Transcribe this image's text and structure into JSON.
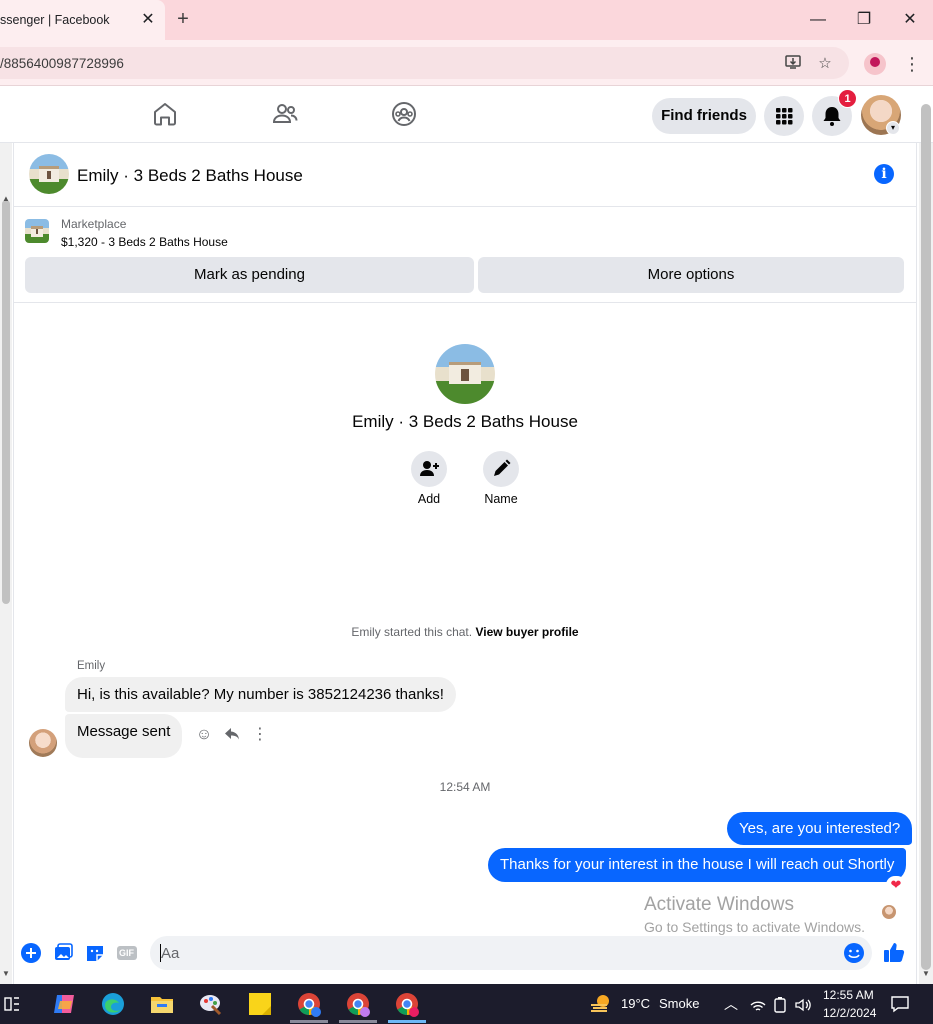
{
  "browser": {
    "tab_title": "ssenger | Facebook",
    "tab_close": "✕",
    "new_tab": "+",
    "url": "/8856400987728996",
    "window_minimize": "—",
    "window_restore": "❐",
    "window_close": "✕",
    "menu": "⋮"
  },
  "fb_nav": {
    "find_friends": "Find friends",
    "notification_count": "1"
  },
  "chat": {
    "title": "Emily · 3 Beds 2 Baths House",
    "marketplace_label": "Marketplace",
    "listing": "$1,320 - 3 Beds 2 Baths House",
    "mark_pending": "Mark as pending",
    "more_options": "More options",
    "profile_name": "Emily · 3 Beds 2 Baths House",
    "add_label": "Add",
    "name_label": "Name",
    "started_text": "Emily started this chat.",
    "view_buyer_profile": "View buyer profile",
    "messages": [
      {
        "sender": "Emily",
        "text": "Hi, is this available? My number is 3852124236 thanks!"
      },
      {
        "text": "Message sent"
      }
    ],
    "timestamp": "12:54 AM",
    "replies": [
      {
        "text": "Yes, are you interested?"
      },
      {
        "text": "Thanks for your interest in the house I will reach out Shortly"
      }
    ],
    "composer_placeholder": "Aa",
    "gif_label": "GIF",
    "reaction": "❤"
  },
  "watermark": {
    "line1": "Activate Windows",
    "line2": "Go to Settings to activate Windows."
  },
  "taskbar": {
    "weather_temp": "19°C",
    "weather_desc": "Smoke",
    "time": "12:55 AM",
    "date": "12/2/2024"
  },
  "colors": {
    "messenger_blue": "#0866ff",
    "badge_red": "#e41e3f",
    "chrome_tab_pink": "#fbd7dc"
  }
}
